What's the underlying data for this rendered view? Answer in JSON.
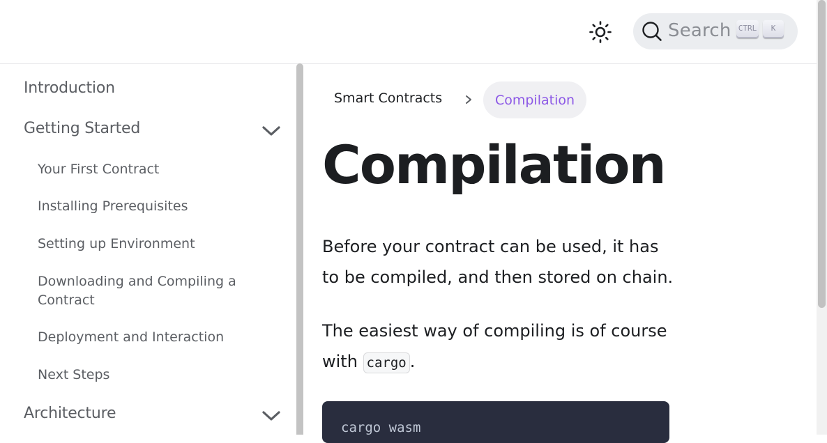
{
  "header": {
    "search": {
      "placeholder": "Search",
      "shortcut_ctrl": "CTRL",
      "shortcut_key": "K"
    },
    "theme_icon": "sun-icon"
  },
  "sidebar": {
    "items": [
      {
        "label": "Introduction"
      },
      {
        "label": "Getting Started",
        "expanded": true,
        "children": [
          {
            "label": "Your First Contract"
          },
          {
            "label": "Installing Prerequisites"
          },
          {
            "label": "Setting up Environment"
          },
          {
            "label": "Downloading and Compiling a Contract"
          },
          {
            "label": "Deployment and Interaction"
          },
          {
            "label": "Next Steps"
          }
        ]
      },
      {
        "label": "Architecture",
        "expanded": false
      }
    ]
  },
  "breadcrumb": {
    "parent": "Smart Contracts",
    "current": "Compilation"
  },
  "content": {
    "title": "Compilation",
    "para1": "Before your contract can be used, it has to be compiled, and then stored on chain.",
    "para2_prefix": "The easiest way of compiling is of course with ",
    "para2_code": "cargo",
    "para2_suffix": ".",
    "code_line": "cargo wasm"
  },
  "colors": {
    "accent": "#8c58e6",
    "code_bg": "#292d3e",
    "search_bg": "#ebedf0"
  }
}
